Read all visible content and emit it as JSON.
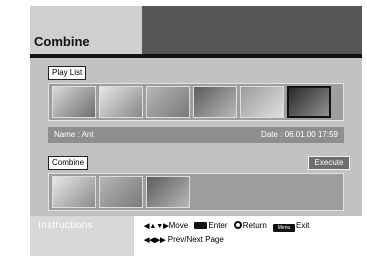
{
  "header": {
    "title": "Combine"
  },
  "playlist": {
    "label": "Play List",
    "thumbnails": [
      {
        "name": "thumb-1",
        "colors": [
          "#d9d9d9",
          "#6f6f6f"
        ],
        "selected": false
      },
      {
        "name": "thumb-2",
        "colors": [
          "#e6e6e6",
          "#888888"
        ],
        "selected": false
      },
      {
        "name": "thumb-3",
        "colors": [
          "#b5b5b5",
          "#7a7a7a"
        ],
        "selected": false
      },
      {
        "name": "thumb-4",
        "colors": [
          "#5c5c5c",
          "#b8b8b8"
        ],
        "selected": false
      },
      {
        "name": "thumb-5",
        "colors": [
          "#9a9a9a",
          "#e0e0e0"
        ],
        "selected": false
      },
      {
        "name": "thumb-6",
        "colors": [
          "#2a2a2a",
          "#909090"
        ],
        "selected": true
      }
    ]
  },
  "info": {
    "name": "Name : Ant",
    "date": "Date : 06.01.00 17:59"
  },
  "combine": {
    "label": "Combine",
    "execute_label": "Execute",
    "thumbnails": [
      {
        "name": "combine-thumb-1",
        "colors": [
          "#e8e8e8",
          "#8a8a8a"
        ]
      },
      {
        "name": "combine-thumb-2",
        "colors": [
          "#b5b5b5",
          "#7a7a7a"
        ]
      },
      {
        "name": "combine-thumb-3",
        "colors": [
          "#5c5c5c",
          "#b8b8b8"
        ]
      }
    ]
  },
  "footer": {
    "instructions_label": "Instructions",
    "move_glyph": "◀▲▼▶",
    "move_label": "Move",
    "enter_label": "Enter",
    "return_label": "Return",
    "menu_key": "Menu",
    "exit_label": "Exit",
    "page_glyph": "◀◀▶▶",
    "page_label": "Prev/Next Page"
  }
}
